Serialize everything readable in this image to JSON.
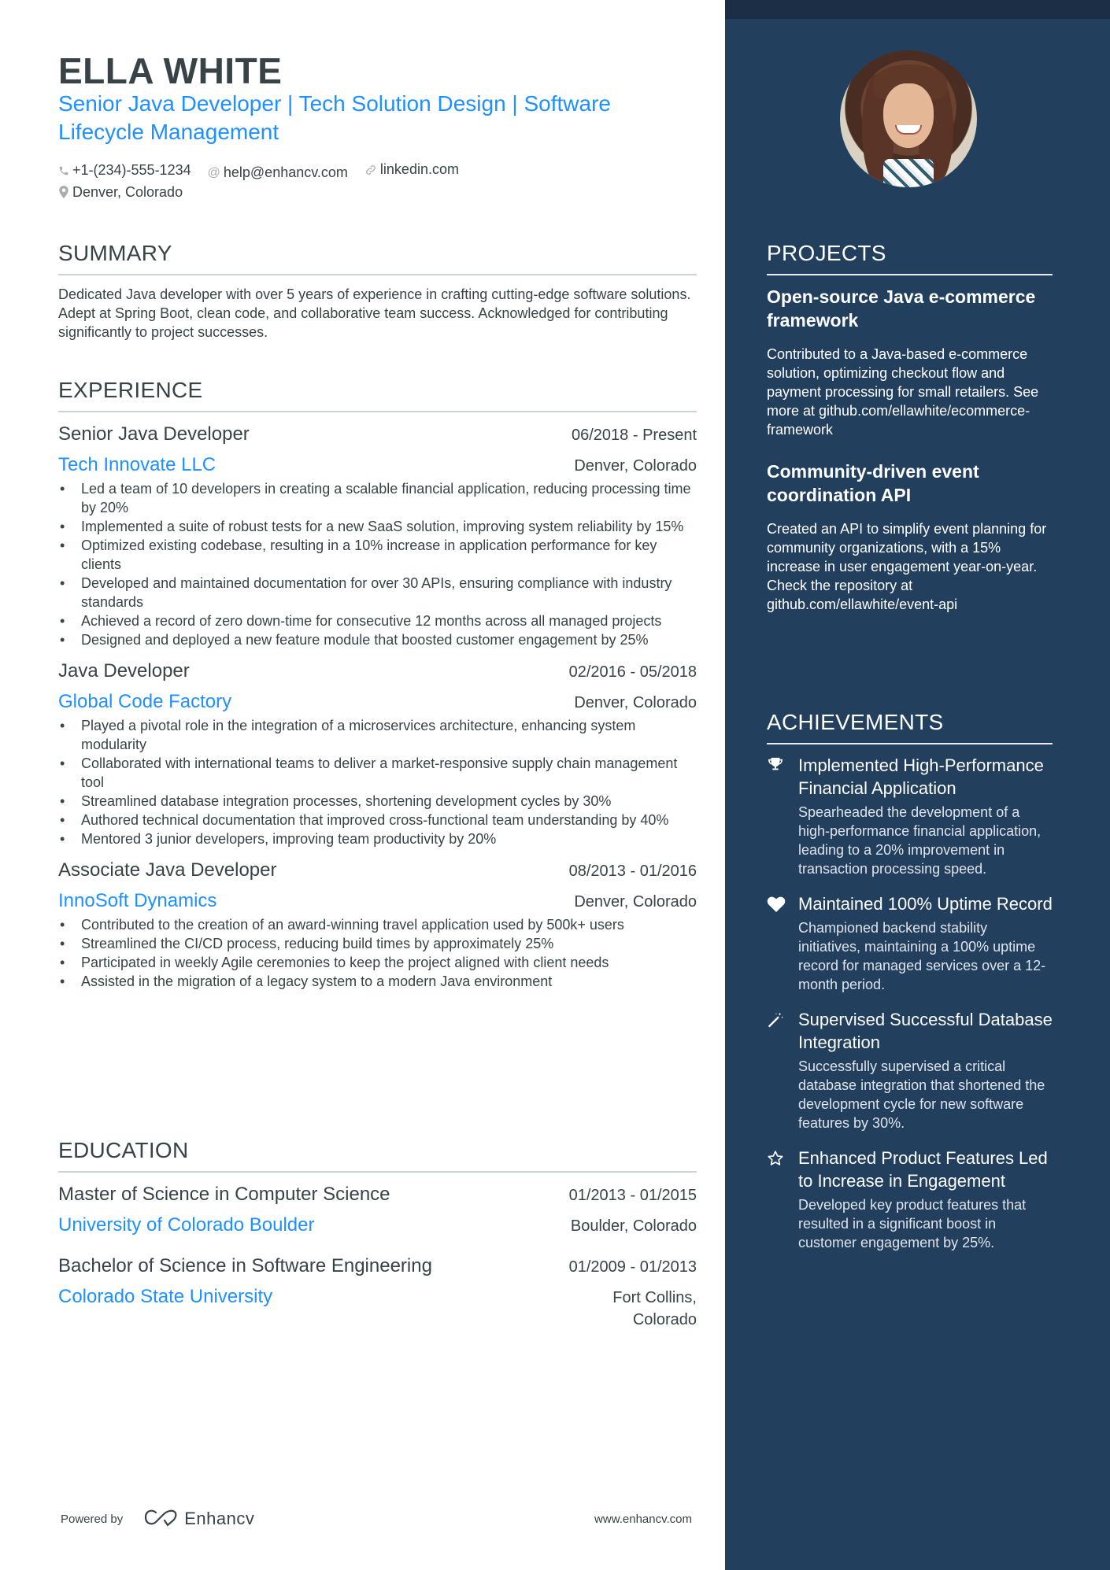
{
  "header": {
    "name": "ELLA WHITE",
    "tagline": "Senior Java Developer | Tech Solution Design | Software Lifecycle Management",
    "contacts": {
      "phone": {
        "icon": "phone-icon",
        "value": "+1-(234)-555-1234"
      },
      "email": {
        "icon": "at-icon",
        "value": "help@enhancv.com"
      },
      "link": {
        "icon": "link-icon",
        "value": "linkedin.com"
      },
      "location": {
        "icon": "location-pin-icon",
        "value": "Denver, Colorado"
      }
    }
  },
  "summary": {
    "title": "SUMMARY",
    "text": "Dedicated Java developer with over 5 years of experience in crafting cutting-edge software solutions. Adept at Spring Boot, clean code, and collaborative team success. Acknowledged for contributing significantly to project successes."
  },
  "experience": {
    "title": "EXPERIENCE",
    "items": [
      {
        "role": "Senior Java Developer",
        "dates": "06/2018 - Present",
        "company": "Tech Innovate LLC",
        "location": "Denver, Colorado",
        "bullets": [
          "Led a team of 10 developers in creating a scalable financial application, reducing processing time by 20%",
          "Implemented a suite of robust tests for a new SaaS solution, improving system reliability by 15%",
          "Optimized existing codebase, resulting in a 10% increase in application performance for key clients",
          "Developed and maintained documentation for over 30 APIs, ensuring compliance with industry standards",
          "Achieved a record of zero down-time for consecutive 12 months across all managed projects",
          "Designed and deployed a new feature module that boosted customer engagement by 25%"
        ]
      },
      {
        "role": "Java Developer",
        "dates": "02/2016 - 05/2018",
        "company": "Global Code Factory",
        "location": "Denver, Colorado",
        "bullets": [
          "Played a pivotal role in the integration of a microservices architecture, enhancing system modularity",
          "Collaborated with international teams to deliver a market-responsive supply chain management tool",
          "Streamlined database integration processes, shortening development cycles by 30%",
          "Authored technical documentation that improved cross-functional team understanding by 40%",
          "Mentored 3 junior developers, improving team productivity by 20%"
        ]
      },
      {
        "role": "Associate Java Developer",
        "dates": "08/2013 - 01/2016",
        "company": "InnoSoft Dynamics",
        "location": "Denver, Colorado",
        "bullets": [
          "Contributed to the creation of an award-winning travel application used by 500k+ users",
          "Streamlined the CI/CD process, reducing build times by approximately 25%",
          "Participated in weekly Agile ceremonies to keep the project aligned with client needs",
          "Assisted in the migration of a legacy system to a modern Java environment"
        ]
      }
    ]
  },
  "education": {
    "title": "EDUCATION",
    "items": [
      {
        "degree": "Master of Science in Computer Science",
        "dates": "01/2013 - 01/2015",
        "school": "University of Colorado Boulder",
        "location": "Boulder, Colorado"
      },
      {
        "degree": "Bachelor of Science in Software Engineering",
        "dates": "01/2009 - 01/2013",
        "school": "Colorado State University",
        "location": "Fort Collins, Colorado"
      }
    ]
  },
  "projects": {
    "title": "PROJECTS",
    "items": [
      {
        "title": "Open-source Java e-commerce framework",
        "description": "Contributed to a Java-based e-commerce solution, optimizing checkout flow and payment processing for small retailers. See more at github.com/ellawhite/ecommerce-framework"
      },
      {
        "title": "Community-driven event coordination API",
        "description": "Created an API to simplify event planning for community organizations, with a 15% increase in user engagement year-on-year. Check the repository at github.com/ellawhite/event-api"
      }
    ]
  },
  "achievements": {
    "title": "ACHIEVEMENTS",
    "items": [
      {
        "icon": "trophy-icon",
        "title": "Implemented High-Performance Financial Application",
        "description": "Spearheaded the development of a high-performance financial application, leading to a 20% improvement in transaction processing speed."
      },
      {
        "icon": "heart-icon",
        "title": "Maintained 100% Uptime Record",
        "description": "Championed backend stability initiatives, maintaining a 100% uptime record for managed services over a 12-month period."
      },
      {
        "icon": "magic-wand-icon",
        "title": "Supervised Successful Database Integration",
        "description": "Successfully supervised a critical database integration that shortened the development cycle for new software features by 30%."
      },
      {
        "icon": "star-outline-icon",
        "title": "Enhanced Product Features Led to Increase in Engagement",
        "description": "Developed key product features that resulted in a significant boost in customer engagement by 25%."
      }
    ]
  },
  "footer": {
    "powered_by": "Powered by",
    "brand": "Enhancv",
    "url": "www.enhancv.com"
  },
  "colors": {
    "accent": "#1e90ff",
    "text": "#384347",
    "sidebar": "#22405e",
    "sidebar_band": "#1c2e45"
  }
}
